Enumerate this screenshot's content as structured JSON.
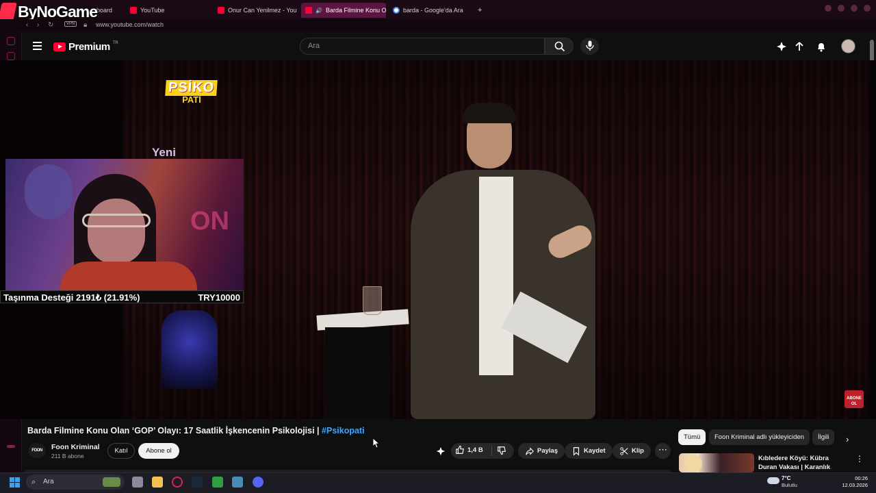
{
  "browser": {
    "brand": "ByNoGame",
    "tabs": [
      {
        "label": "board",
        "favicon": "dashboard-icon"
      },
      {
        "label": "YouTube",
        "favicon": "youtube-icon"
      },
      {
        "label": "Onur Can Yenilmez - YouT",
        "favicon": "youtube-icon"
      },
      {
        "label": "Barda Filmine Konu Ol",
        "favicon": "speaker-icon",
        "active": true
      },
      {
        "label": "barda - Google'da Ara",
        "favicon": "google-icon"
      }
    ],
    "new_tab": "+",
    "vpn_badge": "VPN",
    "url": "www.youtube.com/watch"
  },
  "youtube": {
    "logo_text": "Premium",
    "logo_region": "TR",
    "search_placeholder": "Ara"
  },
  "video": {
    "overlay_logo_top": "PSİKO",
    "overlay_logo_bottom": "PATİ",
    "overlay_text_new": "Yeni",
    "donation_label": "Taşınma Desteği 2191₺ (21.91%)",
    "donation_progress": 0.2191,
    "donation_goal": "TRY10000",
    "subscribe_badge_top": "ABONE",
    "subscribe_badge_bottom": "OL",
    "title_main": "Barda Filmine Konu Olan ‘GOP’ Olayı: 17 Saatlik İşkencenin Psikolojisi | ",
    "title_hashtag": "#Psikopati"
  },
  "channel": {
    "avatar_text": "FOON",
    "name": "Foon Kriminal",
    "subscribers": "211 B abone",
    "join_label": "Katıl",
    "subscribe_label": "Abone ol"
  },
  "actions": {
    "likes": "1,4 B",
    "share": "Paylaş",
    "save": "Kaydet",
    "clip": "Klip",
    "more": "⋯"
  },
  "sidebar_right": {
    "chips": [
      "Tümü",
      "Foon Kriminal adlı yükleyiciden",
      "İlgili"
    ],
    "recommendation_title": "Kıbledere Köyü: Kübra Duran Vakası | Karanlık Hikâyeler"
  },
  "taskbar": {
    "search_placeholder": "Ara",
    "temperature": "7°C",
    "weather": "Bulutlu",
    "time": "00:26",
    "date": "12.03.2026"
  },
  "colors": {
    "accent_red": "#ff0033",
    "hashtag_blue": "#3ea6ff",
    "browser_bg": "#1a0a14",
    "active_tab": "#5a1540"
  }
}
